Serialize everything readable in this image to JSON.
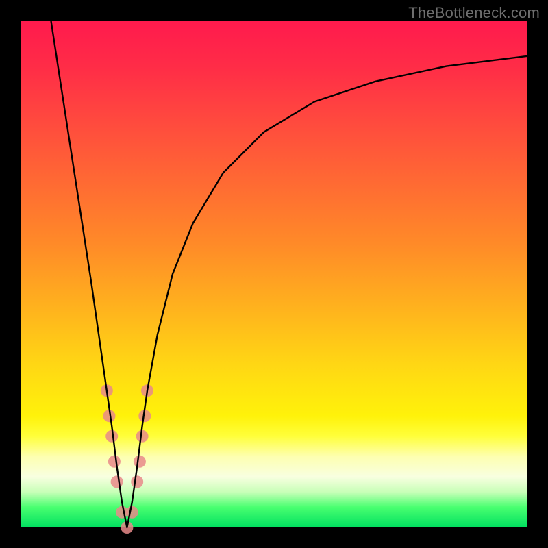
{
  "watermark": "TheBottleneck.com",
  "chart_data": {
    "type": "line",
    "title": "",
    "xlabel": "",
    "ylabel": "",
    "xlim": [
      0,
      100
    ],
    "ylim": [
      0,
      100
    ],
    "grid": false,
    "legend": false,
    "minimum_x": 21,
    "series": [
      {
        "name": "curve",
        "color": "#000000",
        "x": [
          6,
          8,
          10,
          12,
          14,
          16,
          17,
          18,
          19,
          20,
          21,
          22,
          23,
          24,
          25,
          27,
          30,
          34,
          40,
          48,
          58,
          70,
          84,
          100
        ],
        "y": [
          100,
          87,
          74,
          61,
          48,
          34,
          27,
          20,
          12,
          5,
          0,
          5,
          12,
          20,
          27,
          38,
          50,
          60,
          70,
          78,
          84,
          88,
          91,
          93
        ]
      }
    ],
    "markers": {
      "name": "highlight-dots",
      "color": "#e78a8a",
      "radius_px": 9,
      "points": [
        {
          "x": 17,
          "y": 27
        },
        {
          "x": 17.5,
          "y": 22
        },
        {
          "x": 18,
          "y": 18
        },
        {
          "x": 18.5,
          "y": 13
        },
        {
          "x": 19,
          "y": 9
        },
        {
          "x": 20,
          "y": 3
        },
        {
          "x": 21,
          "y": 0
        },
        {
          "x": 22,
          "y": 3
        },
        {
          "x": 23,
          "y": 9
        },
        {
          "x": 23.5,
          "y": 13
        },
        {
          "x": 24,
          "y": 18
        },
        {
          "x": 24.5,
          "y": 22
        },
        {
          "x": 25,
          "y": 27
        }
      ]
    }
  }
}
